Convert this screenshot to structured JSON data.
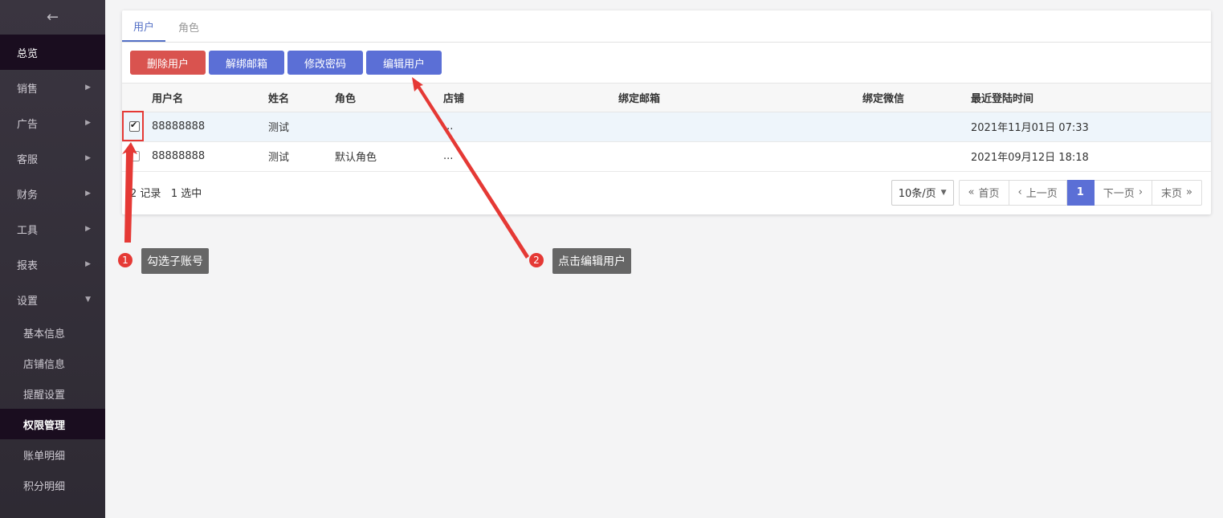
{
  "sidebar": {
    "back_icon": "arrow-left-icon",
    "items": [
      {
        "label": "总览",
        "active": true,
        "has_caret": false
      },
      {
        "label": "销售",
        "has_caret": true,
        "caret": "▶"
      },
      {
        "label": "广告",
        "has_caret": true,
        "caret": "▶"
      },
      {
        "label": "客服",
        "has_caret": true,
        "caret": "▶"
      },
      {
        "label": "财务",
        "has_caret": true,
        "caret": "▶"
      },
      {
        "label": "工具",
        "has_caret": true,
        "caret": "▶"
      },
      {
        "label": "报表",
        "has_caret": true,
        "caret": "▶"
      },
      {
        "label": "设置",
        "has_caret": true,
        "caret": "▼",
        "expanded": true
      }
    ],
    "sub_items": [
      {
        "label": "基本信息"
      },
      {
        "label": "店铺信息"
      },
      {
        "label": "提醒设置"
      },
      {
        "label": "权限管理",
        "active": true
      },
      {
        "label": "账单明细"
      },
      {
        "label": "积分明细"
      }
    ]
  },
  "tabs": [
    {
      "label": "用户",
      "active": true
    },
    {
      "label": "角色",
      "active": false
    }
  ],
  "toolbar": {
    "delete_label": "删除用户",
    "unbind_label": "解绑邮箱",
    "password_label": "修改密码",
    "edit_label": "编辑用户"
  },
  "table": {
    "columns": [
      "用户名",
      "姓名",
      "角色",
      "店铺",
      "绑定邮箱",
      "绑定微信",
      "最近登陆时间"
    ],
    "rows": [
      {
        "selected": true,
        "username": "88888888",
        "name": "测试",
        "role": "",
        "store": "...",
        "email": "",
        "wechat": "",
        "last_login": "2021年11月01日 07:33"
      },
      {
        "selected": false,
        "username": "88888888",
        "name": "测试",
        "role": "默认角色",
        "store": "...",
        "email": "",
        "wechat": "",
        "last_login": "2021年09月12日 18:18"
      }
    ]
  },
  "footer": {
    "records": "2 记录",
    "selected": "1 选中"
  },
  "pager": {
    "page_size": "10条/页",
    "first": "首页",
    "prev": "上一页",
    "current": "1",
    "next": "下一页",
    "last": "末页"
  },
  "annotations": [
    {
      "number": "1",
      "text": "勾选子账号"
    },
    {
      "number": "2",
      "text": "点击编辑用户"
    }
  ],
  "colors": {
    "accent": "#5b6fd6",
    "danger": "#d9534f",
    "annotation": "#e53935"
  }
}
